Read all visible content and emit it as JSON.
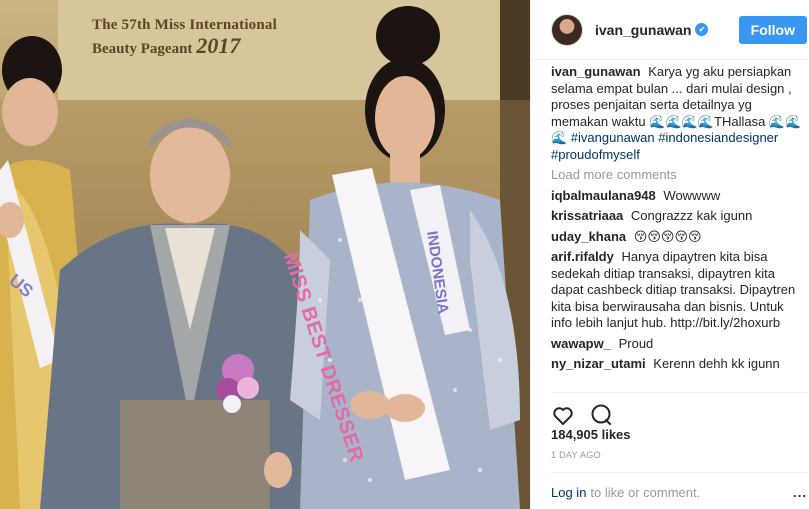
{
  "photo": {
    "banner": {
      "line1": "The 57th Miss International",
      "line2": "Beauty Pageant",
      "year": "2017"
    },
    "sash_main": "MISS BEST DRESSER",
    "sash_right": "INDONESIA",
    "sash_left": "US"
  },
  "post": {
    "username": "ivan_gunawan",
    "follow_label": "Follow",
    "caption": {
      "user": "ivan_gunawan",
      "text": "Karya yg aku persiapkan selama empat bulan ... dari mulai design , proses penjaitan serta detailnya yg memakan waktu 🌊🌊🌊🌊THallasa 🌊🌊",
      "tags": "🌊 #ivangunawan #indonesiandesigner #proudofmyself"
    },
    "load_more": "Load more comments",
    "comments": [
      {
        "user": "iqbalmaulana948",
        "text": "Wowwww"
      },
      {
        "user": "krissatriaaa",
        "text": "Congrazzz kak igunn"
      },
      {
        "user": "uday_khana",
        "text": "😚😚😚😚😚"
      },
      {
        "user": "arif.rifaldy",
        "text": "Hanya dipaytren kita bisa sedekah ditiap transaksi, dipaytren kita dapat cashbeck ditiap transaksi. Dipaytren kita bisa berwirausaha dan bisnis. Untuk info lebih lanjut hub. http://bit.ly/2hoxurb"
      },
      {
        "user": "wawapw_",
        "text": "Proud"
      },
      {
        "user": "ny_nizar_utami",
        "text": "Kerenn dehh kk igunn"
      }
    ],
    "likes": "184,905 likes",
    "time": "1 DAY AGO",
    "footer": {
      "login": "Log in",
      "rest": "to like or comment.",
      "more": "..."
    }
  },
  "colors": {
    "accent": "#3897f0",
    "hashtag": "#003569",
    "muted": "#999999"
  },
  "icons": {
    "like": "heart-icon",
    "comment": "comment-icon",
    "verified": "verified-check-icon",
    "more": "more-options-icon"
  }
}
